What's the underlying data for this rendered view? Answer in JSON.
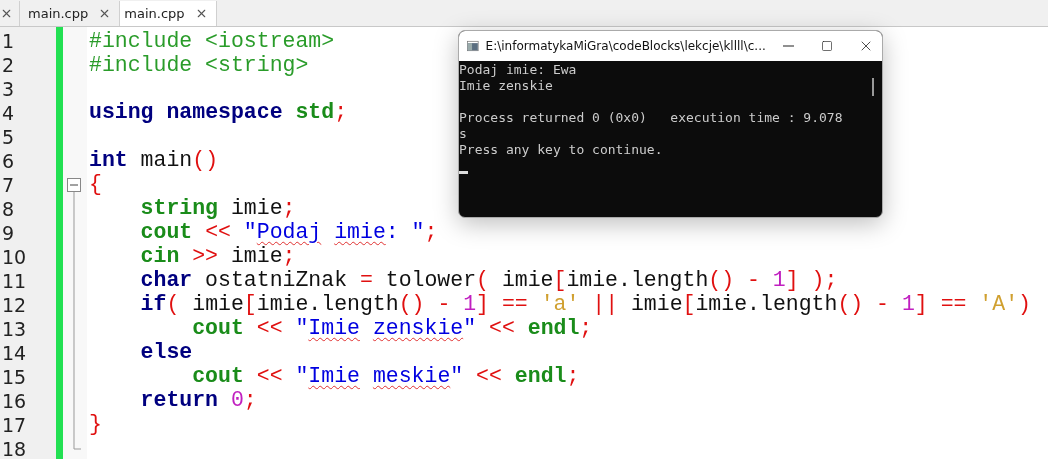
{
  "tabs": {
    "partial_tab": true,
    "items": [
      {
        "label": "main.cpp",
        "selected": false
      },
      {
        "label": "main.cpp",
        "selected": true
      }
    ]
  },
  "editor": {
    "lines": [
      {
        "number": "1",
        "fold_start": false,
        "tokens": [
          {
            "text": "#include <iostream>",
            "kind": "pre"
          }
        ]
      },
      {
        "number": "2",
        "fold_start": false,
        "tokens": [
          {
            "text": "#include <string>",
            "kind": "pre"
          }
        ]
      },
      {
        "number": "3",
        "fold_start": false
      },
      {
        "number": "4",
        "fold_start": false,
        "tokens": [
          {
            "text": "using ",
            "kind": "keyword"
          },
          {
            "text": "namespace ",
            "kind": "keyword"
          },
          {
            "text": "std",
            "kind": "type"
          },
          {
            "text": ";",
            "kind": "op"
          }
        ]
      },
      {
        "number": "5",
        "fold_start": false
      },
      {
        "number": "6",
        "fold_start": false,
        "tokens": [
          {
            "text": "int",
            "kind": "keyword"
          },
          {
            "text": " main",
            "kind": "plain"
          },
          {
            "text": "()",
            "kind": "op"
          }
        ]
      },
      {
        "number": "7",
        "fold_start": true,
        "tokens": [
          {
            "text": "{",
            "kind": "op"
          }
        ]
      },
      {
        "number": "8",
        "fold_start": false,
        "tokens": [
          {
            "text": "    string",
            "kind": "type"
          },
          {
            "text": " imie",
            "kind": "plain"
          },
          {
            "text": ";",
            "kind": "op"
          }
        ]
      },
      {
        "number": "9",
        "fold_start": false,
        "tokens": [
          {
            "text": "    cout ",
            "kind": "type"
          },
          {
            "text": "<< ",
            "kind": "op"
          },
          {
            "text": "\"",
            "kind": "string"
          },
          {
            "text": "Podaj",
            "kind": "misspelled"
          },
          {
            "text": " imie",
            "kind": "misspelled"
          },
          {
            "text": ": \"",
            "kind": "string"
          },
          {
            "text": ";",
            "kind": "op"
          }
        ]
      },
      {
        "number": "10",
        "fold_start": false,
        "tokens": [
          {
            "text": "    cin ",
            "kind": "type"
          },
          {
            "text": ">>",
            "kind": "op"
          },
          {
            "text": " imie",
            "kind": "plain"
          },
          {
            "text": ";",
            "kind": "op"
          }
        ]
      },
      {
        "number": "11",
        "fold_start": false,
        "tokens": [
          {
            "text": "    char",
            "kind": "keyword"
          },
          {
            "text": " ostatniZnak ",
            "kind": "plain"
          },
          {
            "text": "=",
            "kind": "op"
          },
          {
            "text": " tolower",
            "kind": "plain"
          },
          {
            "text": "(",
            "kind": "op"
          },
          {
            "text": " imie",
            "kind": "plain"
          },
          {
            "text": "[",
            "kind": "op"
          },
          {
            "text": "imie.length",
            "kind": "plain"
          },
          {
            "text": "() - ",
            "kind": "op"
          },
          {
            "text": "1",
            "kind": "number"
          },
          {
            "text": "] );",
            "kind": "op"
          }
        ]
      },
      {
        "number": "12",
        "fold_start": false,
        "tokens": [
          {
            "text": "    if",
            "kind": "keyword"
          },
          {
            "text": "(",
            "kind": "op"
          },
          {
            "text": " imie",
            "kind": "plain"
          },
          {
            "text": "[",
            "kind": "op"
          },
          {
            "text": "imie.length",
            "kind": "plain"
          },
          {
            "text": "() - ",
            "kind": "op"
          },
          {
            "text": "1",
            "kind": "number"
          },
          {
            "text": "] == ",
            "kind": "op"
          },
          {
            "text": "'a' ",
            "kind": "char"
          },
          {
            "text": "||",
            "kind": "op"
          },
          {
            "text": " imie",
            "kind": "plain"
          },
          {
            "text": "[",
            "kind": "op"
          },
          {
            "text": "imie.length",
            "kind": "plain"
          },
          {
            "text": "() - ",
            "kind": "op"
          },
          {
            "text": "1",
            "kind": "number"
          },
          {
            "text": "] == ",
            "kind": "op"
          },
          {
            "text": "'A'",
            "kind": "char"
          },
          {
            "text": ")",
            "kind": "op"
          }
        ]
      },
      {
        "number": "13",
        "fold_start": false,
        "tokens": [
          {
            "text": "        cout ",
            "kind": "type"
          },
          {
            "text": "<< ",
            "kind": "op"
          },
          {
            "text": "\"",
            "kind": "string"
          },
          {
            "text": "Imie",
            "kind": "misspelled"
          },
          {
            "text": " zenskie",
            "kind": "misspelled"
          },
          {
            "text": "\" ",
            "kind": "string"
          },
          {
            "text": "<< ",
            "kind": "op"
          },
          {
            "text": "endl",
            "kind": "type"
          },
          {
            "text": ";",
            "kind": "op"
          }
        ]
      },
      {
        "number": "14",
        "fold_start": false,
        "tokens": [
          {
            "text": "    else",
            "kind": "keyword"
          }
        ]
      },
      {
        "number": "15",
        "fold_start": false,
        "tokens": [
          {
            "text": "        cout ",
            "kind": "type"
          },
          {
            "text": "<< ",
            "kind": "op"
          },
          {
            "text": "\"",
            "kind": "string"
          },
          {
            "text": "Imie",
            "kind": "misspelled"
          },
          {
            "text": " meskie",
            "kind": "misspelled"
          },
          {
            "text": "\" ",
            "kind": "string"
          },
          {
            "text": "<< ",
            "kind": "op"
          },
          {
            "text": "endl",
            "kind": "type"
          },
          {
            "text": ";",
            "kind": "op"
          }
        ]
      },
      {
        "number": "16",
        "fold_start": false,
        "tokens": [
          {
            "text": "    return ",
            "kind": "keyword"
          },
          {
            "text": "0",
            "kind": "number"
          },
          {
            "text": ";",
            "kind": "op"
          }
        ]
      },
      {
        "number": "17",
        "fold_start": false,
        "tokens": [
          {
            "text": "}",
            "kind": "op"
          }
        ]
      },
      {
        "number": "18",
        "fold_start": false
      }
    ]
  },
  "console": {
    "title": "E:\\informatykaMiGra\\codeBlocks\\lekcje\\kllll\\c...",
    "lines": [
      {
        "text": "Podaj imie: Ewa",
        "gap_before": false
      },
      {
        "text": "Imie zenskie",
        "gap_before": false
      },
      {
        "text": "Process returned 0 (0x0)   execution time : 9.078",
        "gap_before": true
      },
      {
        "text": "s",
        "gap_before": false
      },
      {
        "text": "Press any key to continue.",
        "gap_before": false
      }
    ],
    "cursor": true
  }
}
